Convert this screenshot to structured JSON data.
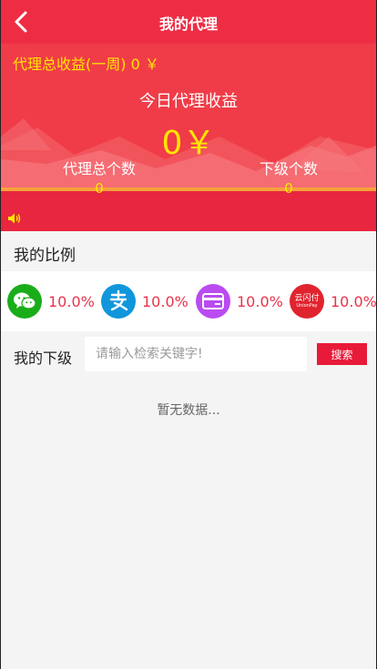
{
  "header": {
    "title": "我的代理",
    "back_icon": "chevron-left-icon"
  },
  "summary": {
    "weekly_label": "代理总收益(一周) 0 ￥",
    "today_label": "今日代理收益",
    "today_value": "0￥",
    "total_agents_label": "代理总个数",
    "total_agents_value": "0",
    "sub_count_label": "下级个数",
    "sub_count_value": "0"
  },
  "notice": {
    "icon": "speaker-icon",
    "text": ""
  },
  "ratio": {
    "title": "我的比例",
    "items": [
      {
        "icon": "wechat-icon",
        "color": "#1aad19",
        "percent": "10.0%"
      },
      {
        "icon": "alipay-icon",
        "color": "#1296db",
        "percent": "10.0%"
      },
      {
        "icon": "card-icon",
        "color": "#b94bf0",
        "percent": "10.0%"
      },
      {
        "icon": "unionpay-icon",
        "color": "#e0242f",
        "percent": "10.0%",
        "logo_text": "云闪付",
        "logo_sub": "UnionPay"
      }
    ]
  },
  "subordinates": {
    "label": "我的下级",
    "search_placeholder": "请输入检索关键字!",
    "search_value": "",
    "search_button": "搜索",
    "empty_text": "暂无数据..."
  },
  "colors": {
    "primary_red": "#ee2d45",
    "highlight_yellow": "#ffe600",
    "button_red": "#e81a39",
    "percent_red": "#e8334a",
    "background": "#f4f4f4"
  }
}
